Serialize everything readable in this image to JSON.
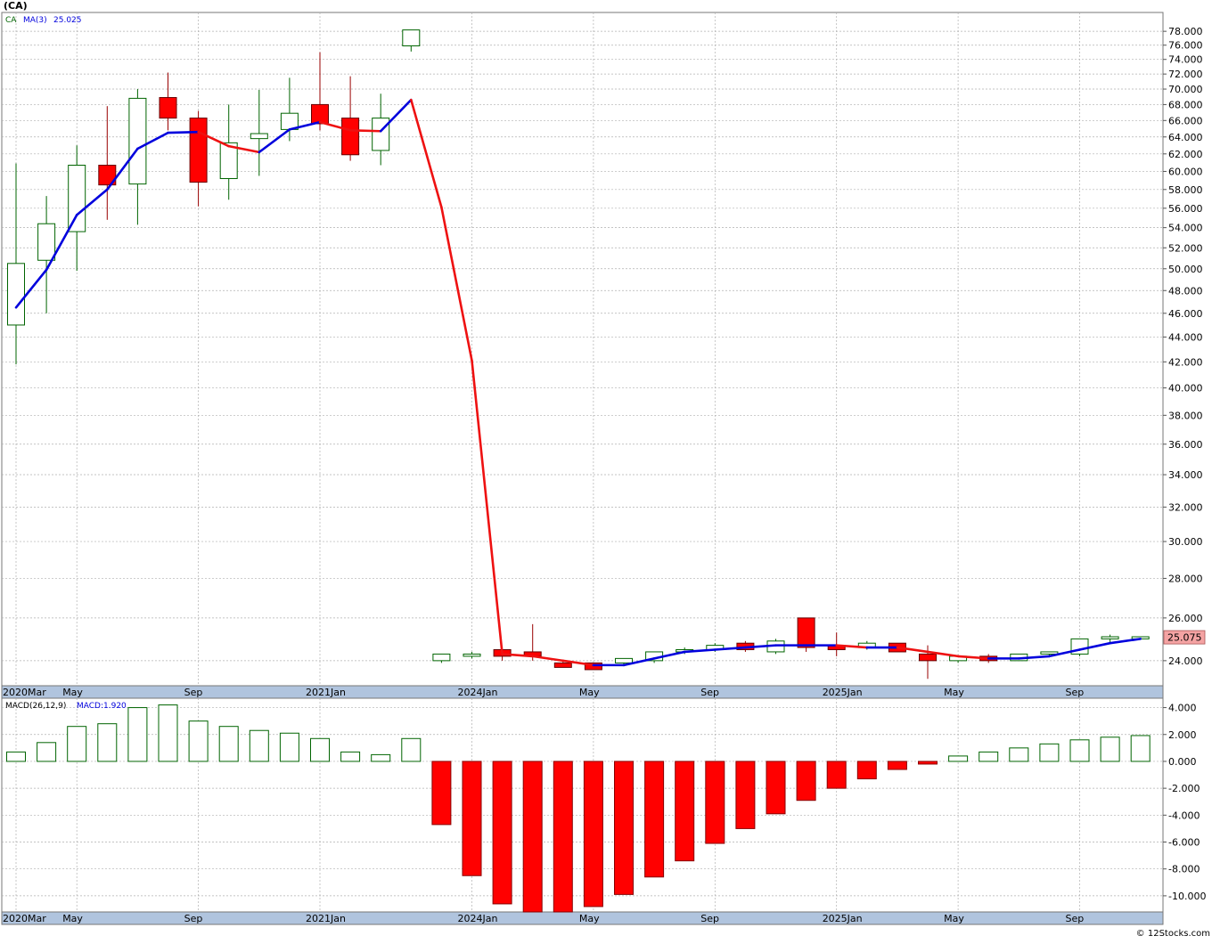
{
  "header": {
    "symbol": "(CA)"
  },
  "footer": {
    "copyright": "© 12Stocks.com"
  },
  "price_panel": {
    "legend_symbol": "CA",
    "legend_ma_label": "MA(3)",
    "legend_ma_value": "25.025",
    "last_price_label": "25.075"
  },
  "macd_panel": {
    "legend_label": "MACD(26,12,9)",
    "legend_value": "MACD:1.920"
  },
  "x_labels": [
    "2020Mar",
    "May",
    "Sep",
    "2021Jan",
    "2024Jan",
    "May",
    "Sep",
    "2025Jan",
    "May",
    "Sep"
  ],
  "x_label_bar_index": [
    0,
    2,
    6,
    10,
    15,
    19,
    23,
    27,
    31,
    35
  ],
  "price_ticks": [
    "78.000",
    "76.000",
    "74.000",
    "72.000",
    "70.000",
    "68.000",
    "66.000",
    "64.000",
    "62.000",
    "60.000",
    "58.000",
    "56.000",
    "54.000",
    "52.000",
    "50.000",
    "48.000",
    "46.000",
    "44.000",
    "42.000",
    "40.000",
    "38.000",
    "36.000",
    "34.000",
    "32.000",
    "30.000",
    "28.000",
    "26.000",
    "24.000"
  ],
  "macd_ticks": [
    "4.000",
    "2.000",
    "0.000",
    "-2.000",
    "-4.000",
    "-6.000",
    "-8.000",
    "-10.000"
  ],
  "colors": {
    "up": "#006400",
    "down": "#ff0000",
    "ma_up": "#0000dd",
    "ma_down": "#ee1111",
    "grid": "#b0b0b0",
    "axis_band": "#b0c4de",
    "badge_bg": "#f4a3a3"
  },
  "chart_data": [
    {
      "type": "candlestick",
      "title": "(CA)",
      "price_scale": "log",
      "ylim": [
        22.9,
        80.8
      ],
      "ohlc": [
        [
          45.0,
          60.9,
          41.8,
          50.5
        ],
        [
          50.8,
          57.3,
          46.0,
          54.4
        ],
        [
          53.6,
          63.0,
          49.8,
          60.7
        ],
        [
          60.7,
          67.8,
          54.8,
          58.5
        ],
        [
          58.6,
          70.0,
          54.3,
          68.8
        ],
        [
          68.9,
          72.2,
          64.8,
          66.3
        ],
        [
          66.3,
          67.2,
          56.2,
          58.8
        ],
        [
          59.2,
          68.0,
          56.9,
          63.3
        ],
        [
          63.8,
          69.9,
          59.5,
          64.4
        ],
        [
          64.9,
          71.5,
          63.5,
          66.9
        ],
        [
          68.0,
          75.0,
          64.8,
          65.6
        ],
        [
          66.3,
          71.7,
          61.2,
          61.9
        ],
        [
          62.4,
          69.4,
          60.7,
          66.3
        ],
        [
          75.9,
          78.2,
          75.1,
          78.2
        ],
        [
          24.0,
          24.3,
          23.9,
          24.3
        ],
        [
          24.2,
          24.4,
          24.1,
          24.3
        ],
        [
          24.5,
          24.6,
          24.0,
          24.2
        ],
        [
          24.4,
          25.7,
          24.0,
          24.2
        ],
        [
          23.9,
          24.0,
          23.7,
          23.7
        ],
        [
          23.9,
          23.9,
          23.6,
          23.6
        ],
        [
          23.9,
          24.1,
          23.8,
          24.1
        ],
        [
          24.0,
          24.4,
          23.9,
          24.4
        ],
        [
          24.4,
          24.6,
          24.3,
          24.5
        ],
        [
          24.5,
          24.8,
          24.4,
          24.7
        ],
        [
          24.8,
          24.9,
          24.4,
          24.5
        ],
        [
          24.4,
          25.0,
          24.3,
          24.9
        ],
        [
          26.0,
          26.0,
          24.4,
          24.6
        ],
        [
          24.7,
          25.3,
          24.2,
          24.5
        ],
        [
          24.6,
          24.9,
          24.5,
          24.8
        ],
        [
          24.8,
          24.8,
          24.4,
          24.4
        ],
        [
          24.3,
          24.7,
          23.2,
          24.0
        ],
        [
          24.0,
          24.2,
          23.9,
          24.2
        ],
        [
          24.2,
          24.3,
          23.9,
          24.0
        ],
        [
          24.0,
          24.3,
          24.0,
          24.3
        ],
        [
          24.3,
          24.4,
          24.2,
          24.4
        ],
        [
          24.3,
          25.0,
          24.2,
          25.0
        ],
        [
          25.0,
          25.2,
          24.8,
          25.1
        ],
        [
          25.0,
          25.1,
          25.0,
          25.1
        ]
      ],
      "ma3": [
        46.5,
        49.9,
        55.3,
        58.0,
        62.6,
        64.5,
        64.6,
        62.9,
        62.2,
        64.9,
        65.8,
        64.8,
        64.7,
        68.6,
        56.1,
        42.1,
        24.3,
        24.2,
        24.0,
        23.8,
        23.8,
        24.1,
        24.4,
        24.5,
        24.6,
        24.7,
        24.7,
        24.7,
        24.6,
        24.6,
        24.4,
        24.2,
        24.1,
        24.1,
        24.2,
        24.5,
        24.8,
        25.0
      ],
      "last_price": 25.075
    },
    {
      "type": "bar",
      "title": "MACD(26,12,9)",
      "ylim": [
        -11.2,
        4.7
      ],
      "values": [
        0.7,
        1.4,
        2.6,
        2.8,
        4.0,
        4.2,
        3.0,
        2.6,
        2.3,
        2.1,
        1.7,
        0.7,
        0.5,
        1.7,
        -4.7,
        -8.5,
        -10.6,
        -11.4,
        -11.5,
        -10.8,
        -9.9,
        -8.6,
        -7.4,
        -6.1,
        -5.0,
        -3.9,
        -2.9,
        -2.0,
        -1.3,
        -0.6,
        -0.2,
        0.4,
        0.7,
        1.0,
        1.3,
        1.6,
        1.8,
        1.92
      ]
    }
  ]
}
